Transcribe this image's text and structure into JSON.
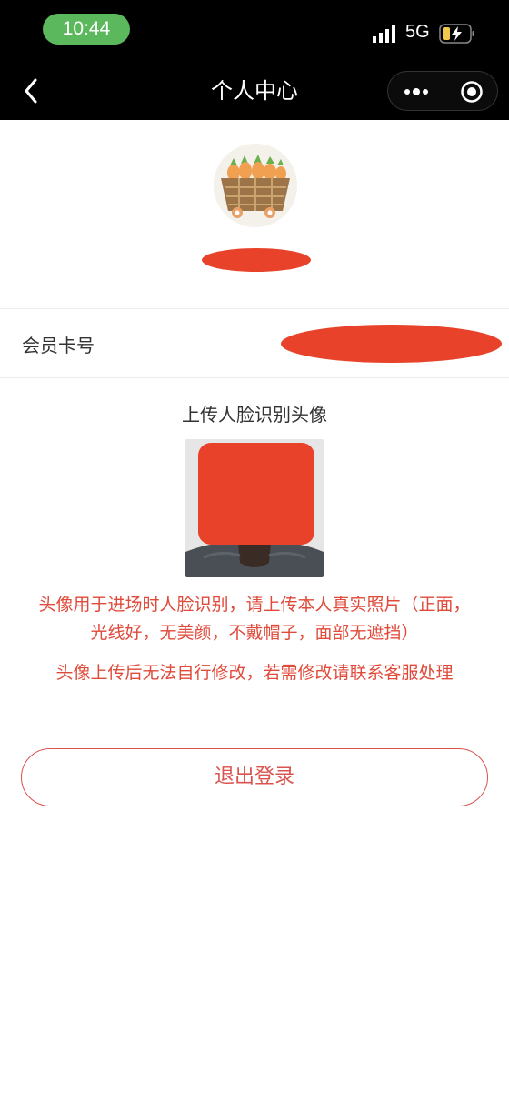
{
  "status_bar": {
    "time": "10:44",
    "network": "5G"
  },
  "nav": {
    "title": "个人中心"
  },
  "member": {
    "label": "会员卡号"
  },
  "upload": {
    "title": "上传人脸识别头像",
    "notice_line1": "头像用于进场时人脸识别，请上传本人真实照片（正面，",
    "notice_line2": "光线好，无美颜，不戴帽子，面部无遮挡）",
    "notice_line3": "头像上传后无法自行修改，若需修改请联系客服处理"
  },
  "actions": {
    "logout_label": "退出登录"
  },
  "colors": {
    "accent": "#e04a3a",
    "redaction": "#e8432a",
    "time_pill": "#5cb85c"
  }
}
